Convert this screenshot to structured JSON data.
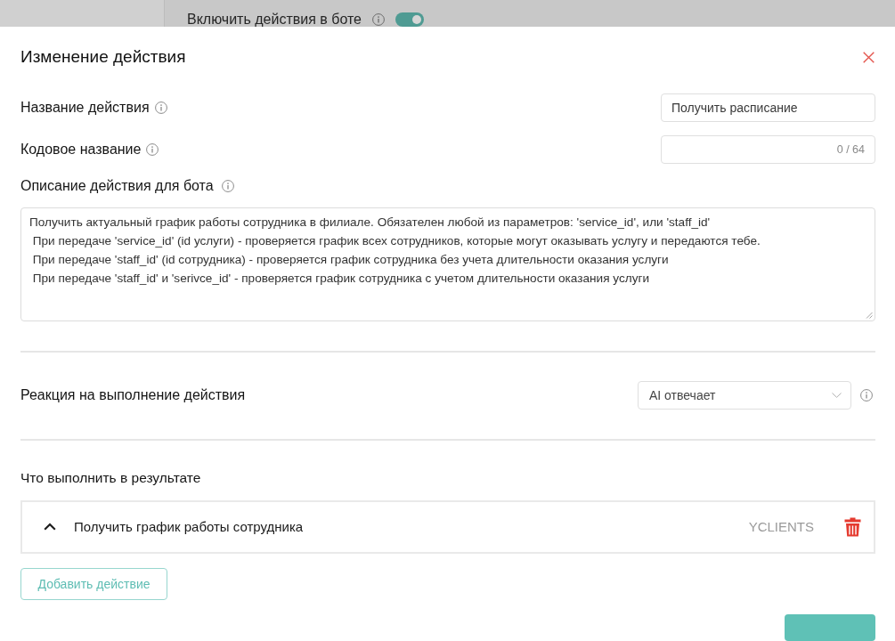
{
  "background": {
    "toggle": {
      "label": "Включить действия в боте",
      "on": true
    }
  },
  "dialog": {
    "title": "Изменение действия"
  },
  "fields": [
    {
      "label": "Название действия",
      "value": "Получить расписание"
    },
    {
      "label": "Кодовое название",
      "counter": "0 / 64"
    }
  ],
  "description": {
    "label": "Описание действия для бота",
    "value": "Получить актуальный график работы сотрудника в филиале. Обязателен любой из параметров: 'service_id', или 'staff_id'\n При передаче 'service_id' (id услуги) - проверяется график всех сотрудников, которые могут оказывать услугу и передаются тебе.\n При передаче 'staff_id' (id сотрудника) - проверяется график сотрудника без учета длительности оказания услуги\n При передаче 'staff_id' и 'serivce_id' - проверяется график сотрудника с учетом длительности оказания услуги"
  },
  "reaction": {
    "label": "Реакция на выполнение действия",
    "value": "AI отвечает"
  },
  "result": {
    "label": "Что выполнить в результате",
    "actions": [
      {
        "title": "Получить график работы сотрудника",
        "source": "YCLIENTS",
        "expanded": true
      }
    ],
    "add_button": "Добавить действие"
  }
}
